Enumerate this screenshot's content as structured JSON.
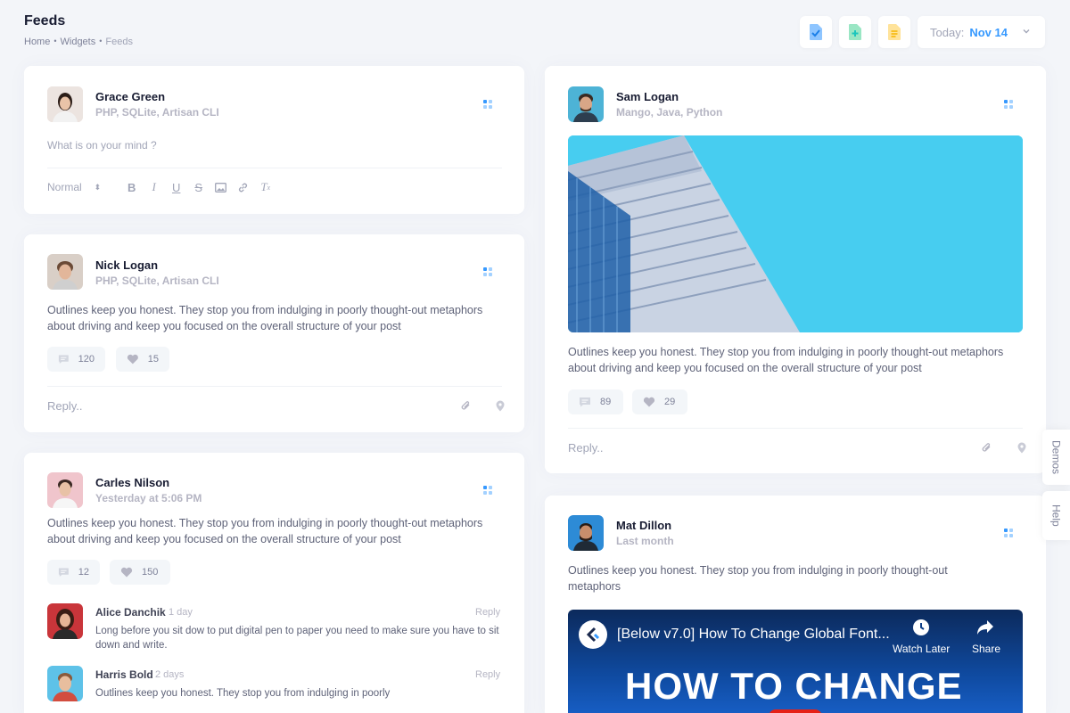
{
  "header": {
    "title": "Feeds",
    "breadcrumb": [
      "Home",
      "Widgets",
      "Feeds"
    ],
    "date_label": "Today:",
    "date_value": "Nov 14"
  },
  "toolbar_icons": [
    "file-check-icon",
    "file-plus-icon",
    "file-text-icon"
  ],
  "composer": {
    "name": "Grace Green",
    "meta": "PHP, SQLite, Artisan CLI",
    "placeholder": "What is on your mind ?",
    "format_select": "Normal"
  },
  "posts": [
    {
      "name": "Nick Logan",
      "meta": "PHP, SQLite, Artisan CLI",
      "text": "Outlines keep you honest. They stop you from indulging in poorly thought-out metaphors about driving and keep you focused on the overall structure of your post",
      "comments": "120",
      "likes": "15",
      "reply_placeholder": "Reply.."
    },
    {
      "name": "Carles Nilson",
      "meta": "Yesterday at 5:06 PM",
      "text": "Outlines keep you honest. They stop you from indulging in poorly thought-out metaphors about driving and keep you focused on the overall structure of your post",
      "comments": "12",
      "likes": "150",
      "replies": [
        {
          "name": "Alice Danchik",
          "time": "1 day",
          "action": "Reply",
          "text": "Long before you sit dow to put digital pen to paper you need to make sure you have to sit down and write."
        },
        {
          "name": "Harris Bold",
          "time": "2 days",
          "action": "Reply",
          "text": "Outlines keep you honest. They stop you from indulging in poorly"
        }
      ]
    },
    {
      "name": "Sam Logan",
      "meta": "Mango, Java, Python",
      "text": "Outlines keep you honest. They stop you from indulging in poorly thought-out metaphors about driving and keep you focused on the overall structure of your post",
      "comments": "89",
      "likes": "29",
      "reply_placeholder": "Reply.."
    },
    {
      "name": "Mat Dillon",
      "meta": "Last month",
      "text": "Outlines keep you honest. They stop you from indulging in poorly thought-out metaphors",
      "video": {
        "title": "[Below v7.0] How To Change Global Font...",
        "watch_later": "Watch Later",
        "share": "Share",
        "thumb_text": "HOW TO CHANGE"
      }
    }
  ],
  "side_tabs": [
    "Demos",
    "Help"
  ],
  "colors": {
    "accent": "#3699ff",
    "photo_sky": "#47cdf0"
  }
}
